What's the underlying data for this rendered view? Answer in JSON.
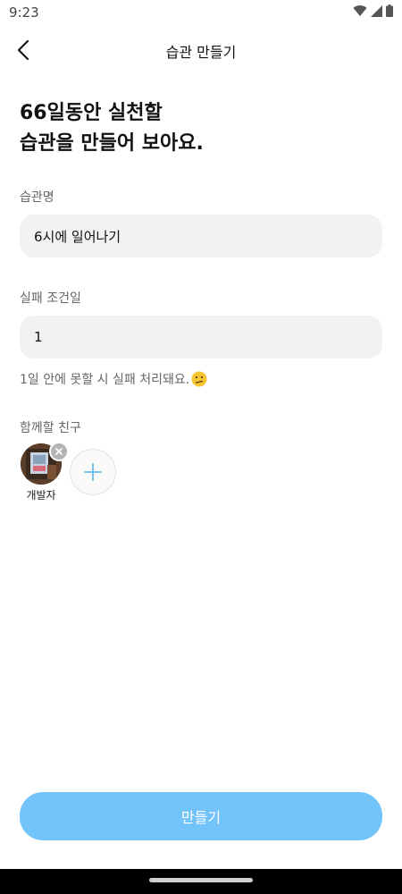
{
  "status_bar": {
    "time": "9:23"
  },
  "header": {
    "title": "습관 만들기"
  },
  "headline": {
    "line1": "66일동안 실천할",
    "line2": "습관을 만들어 보아요."
  },
  "form": {
    "habit_name": {
      "label": "습관명",
      "value": "6시에 일어나기"
    },
    "fail_condition": {
      "label": "실패 조건일",
      "value": "1"
    },
    "helper_text": "1일 안에 못할 시 실패 처리돼요.",
    "friends": {
      "label": "함께할 친구",
      "items": [
        {
          "name": "개발자"
        }
      ]
    }
  },
  "submit": {
    "label": "만들기"
  },
  "colors": {
    "accent": "#73c3fb",
    "input_bg": "#f1f2f4",
    "plus": "#7cc4f0"
  }
}
